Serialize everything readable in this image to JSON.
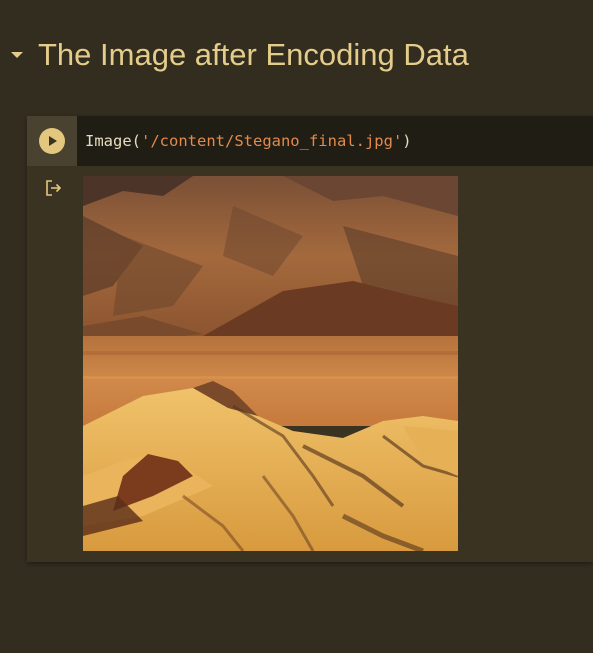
{
  "section": {
    "title": "The Image after Encoding Data",
    "toggle_icon": "caret-down-icon"
  },
  "cell": {
    "run_icon": "play-icon",
    "code": {
      "func": "Image(",
      "arg": "'/content/Stegano_final.jpg'",
      "close": ")"
    },
    "output_icon": "output-redirect-icon",
    "output_image": {
      "description_icon": "landscape-image",
      "colors": {
        "sky_mountain": "#8a5a35",
        "mid_plain": "#c98a45",
        "foreground": "#e7b45a",
        "shadow": "#3a1f12"
      }
    }
  },
  "colors": {
    "background": "#332d20",
    "title": "#e4cc8a",
    "run_button": "#e3c77f",
    "editor_bg": "#201d14",
    "string": "#e38a4c"
  }
}
